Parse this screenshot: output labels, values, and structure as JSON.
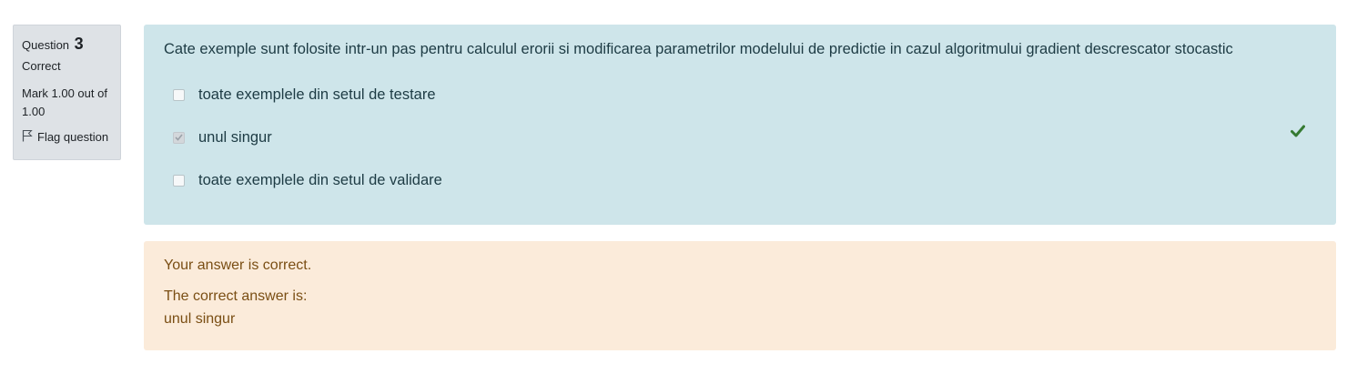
{
  "info": {
    "question_label": "Question",
    "question_number": "3",
    "state": "Correct",
    "grade": "Mark 1.00 out of 1.00",
    "flag_label": "Flag question"
  },
  "question": {
    "text": "Cate exemple sunt folosite intr-un pas pentru calculul erorii si modificarea parametrilor modelului de predictie in cazul algoritmului gradient descrescator stocastic",
    "options": [
      {
        "label": "toate exemplele din setul de testare",
        "checked": false
      },
      {
        "label": "unul singur",
        "checked": true,
        "correct": true
      },
      {
        "label": "toate exemplele din setul de validare",
        "checked": false
      }
    ]
  },
  "outcome": {
    "feedback": "Your answer is correct.",
    "right_answer_label": "The correct answer is:",
    "right_answer": "unul singur"
  },
  "colors": {
    "info_bg": "#dee2e6",
    "formulation_bg": "#cee5ea",
    "outcome_bg": "#fbebda",
    "correct_tick": "#357a32"
  },
  "icons": {
    "flag": "flag-outline-icon",
    "correct": "checkmark-icon"
  }
}
